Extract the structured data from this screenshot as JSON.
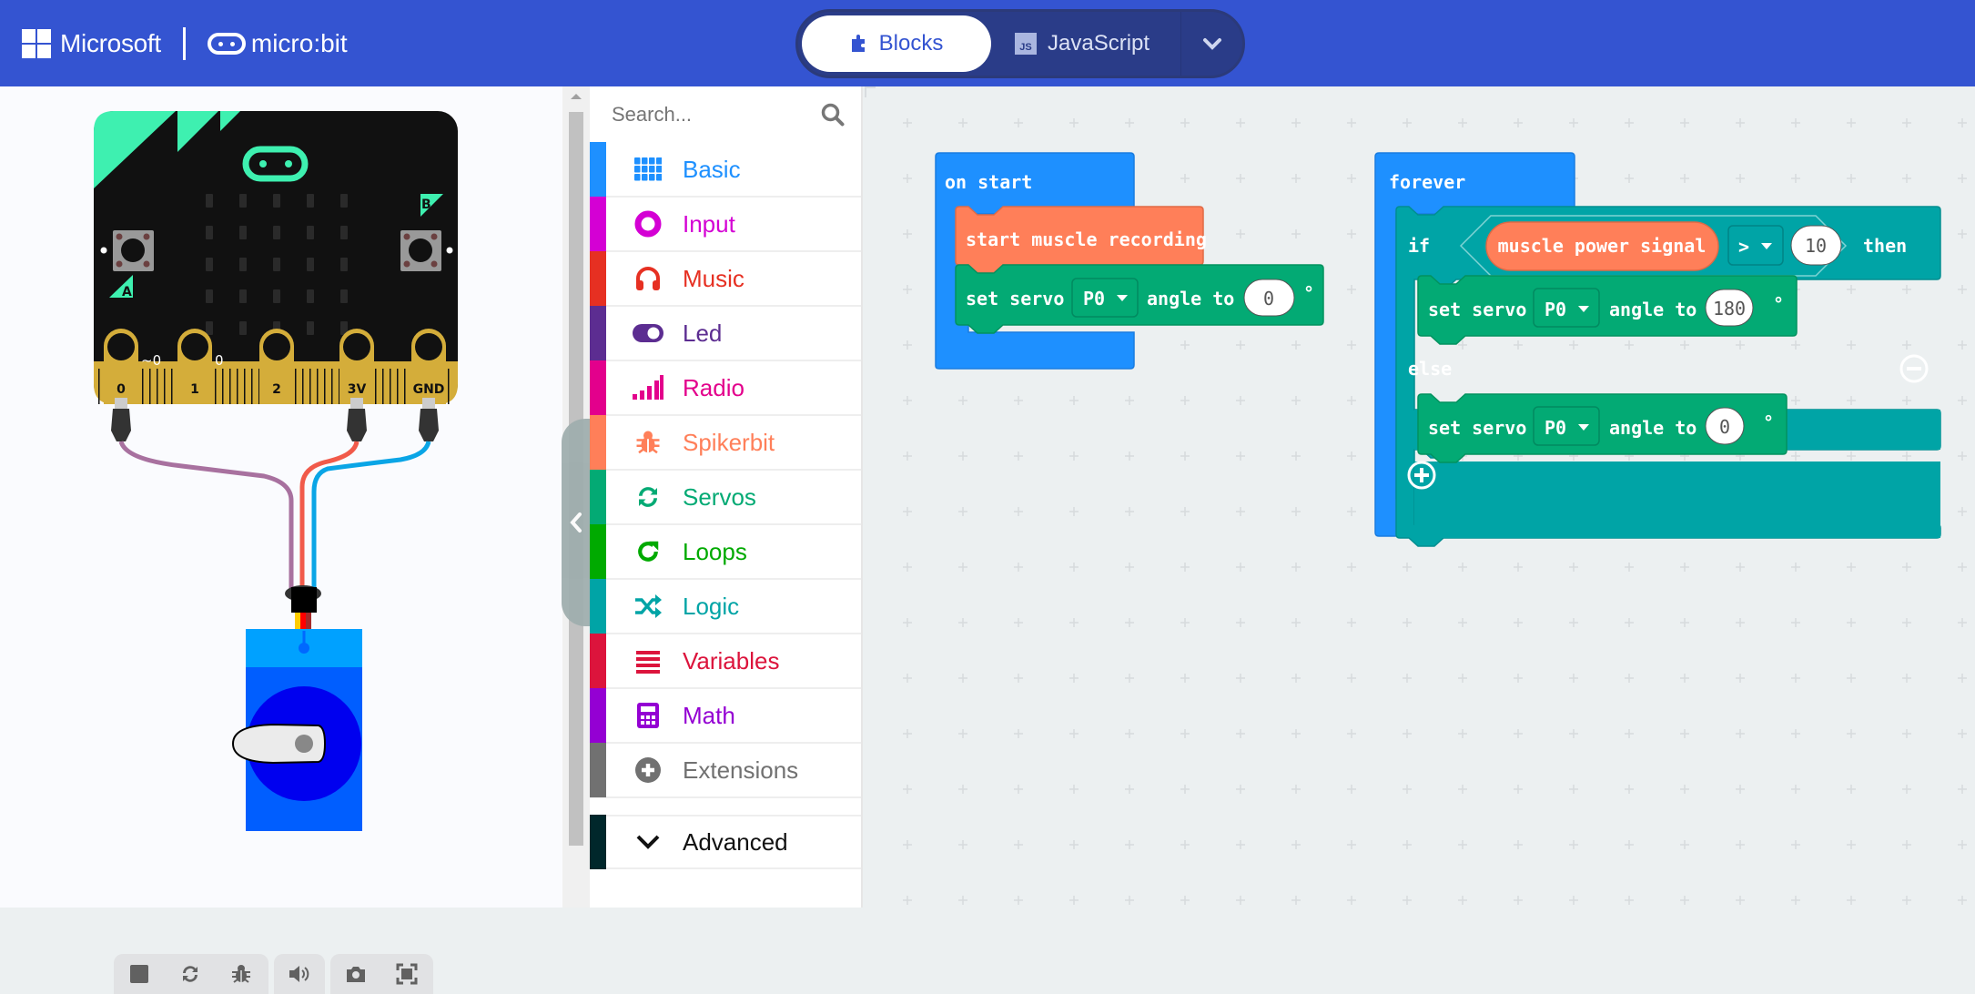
{
  "header": {
    "brand": "Microsoft",
    "product": "micro:bit",
    "tabs": [
      {
        "label": "Blocks",
        "icon": "puzzle-icon",
        "active": true
      },
      {
        "label": "JavaScript",
        "icon_text": "JS",
        "active": false
      }
    ],
    "icons": [
      "home-icon",
      "share-icon",
      "help-icon",
      "settings-icon"
    ],
    "color": "#3454D1"
  },
  "simulator": {
    "board_pin_labels": [
      "0",
      "1",
      "2",
      "3V",
      "GND"
    ],
    "pin_readouts": [
      "~0",
      "0"
    ],
    "button_labels": [
      "A",
      "B"
    ],
    "toolbar": [
      "stop-icon",
      "restart-icon",
      "debug-icon",
      "sound-icon",
      "screenshot-icon",
      "fullscreen-icon"
    ]
  },
  "toolbox": {
    "search_placeholder": "Search...",
    "categories": [
      {
        "label": "Basic",
        "color": "#1E90FF",
        "icon": "grid-icon"
      },
      {
        "label": "Input",
        "color": "#D400D4",
        "icon": "target-icon"
      },
      {
        "label": "Music",
        "color": "#E63022",
        "icon": "headphones-icon"
      },
      {
        "label": "Led",
        "color": "#5C2D91",
        "icon": "toggle-icon"
      },
      {
        "label": "Radio",
        "color": "#E3008C",
        "icon": "signal-bars-icon"
      },
      {
        "label": "Spikerbit",
        "color": "#FF7F59",
        "icon": "bug-icon"
      },
      {
        "label": "Servos",
        "color": "#03AA74",
        "icon": "refresh-icon"
      },
      {
        "label": "Loops",
        "color": "#00AA00",
        "icon": "loop-icon"
      },
      {
        "label": "Logic",
        "color": "#00A4A6",
        "icon": "shuffle-icon"
      },
      {
        "label": "Variables",
        "color": "#DC143C",
        "icon": "list-icon"
      },
      {
        "label": "Math",
        "color": "#9400D3",
        "icon": "calculator-icon"
      },
      {
        "label": "Extensions",
        "color": "#717171",
        "icon": "plus-circle-icon"
      },
      {
        "label": "Advanced",
        "color": "#00272B",
        "icon": "chevron-down-icon"
      }
    ]
  },
  "workspace": {
    "on_start": {
      "label": "on start",
      "blocks": [
        {
          "text": "start muscle recording"
        },
        {
          "prefix": "set servo",
          "pin": "P0",
          "middle": "angle to",
          "value": "0",
          "suffix": "°"
        }
      ]
    },
    "forever": {
      "label": "forever",
      "if_label": "if",
      "then_label": "then",
      "else_label": "else",
      "condition": {
        "reporter": "muscle power signal",
        "operator": ">",
        "value": "10"
      },
      "then_block": {
        "prefix": "set servo",
        "pin": "P0",
        "middle": "angle to",
        "value": "180",
        "suffix": "°"
      },
      "else_block": {
        "prefix": "set servo",
        "pin": "P0",
        "middle": "angle to",
        "value": "0",
        "suffix": "°"
      }
    }
  }
}
